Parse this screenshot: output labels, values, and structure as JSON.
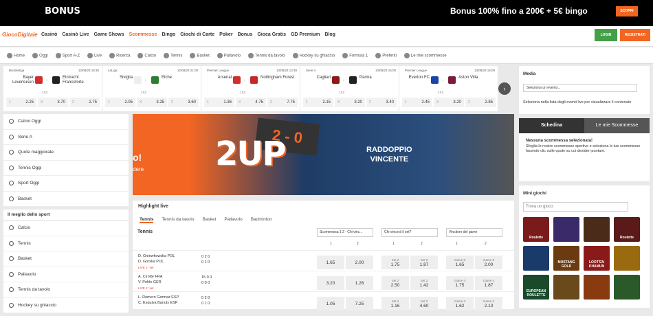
{
  "topbar": {
    "logo": "BONUS BENVENUTO",
    "promo": "Bonus 100% fino a 200€ + 5€ bingo",
    "scopri": "SCOPRI"
  },
  "nav": {
    "brand": "GiocoDigitale",
    "items": [
      "Casinò",
      "Casinò Live",
      "Game Shows",
      "Scommesse",
      "Bingo",
      "Giochi di Carte",
      "Poker",
      "Bonus",
      "Gioca Gratis",
      "GD Premium",
      "Blog"
    ],
    "active": "Scommesse",
    "login": "LOGIN",
    "register": "REGISTRATI"
  },
  "subnav": [
    "Home",
    "Oggi",
    "Sport A-Z",
    "Live",
    "Ricerca",
    "Calcio",
    "Tennis",
    "Basket",
    "Pallavolo",
    "Tennis da tavolo",
    "Hockey su ghiaccio",
    "Formula 1",
    "Preferiti",
    "Le mie scommesse"
  ],
  "matches": [
    {
      "league": "Bundesliga",
      "date": "12/08/23 18:30",
      "home": "Bayer Leverkusen",
      "away": "Eintracht Francoforte",
      "c1": "#d32f2f",
      "c2": "#222",
      "market": "1X2",
      "odds": [
        "2.25",
        "3.70",
        "2.75"
      ]
    },
    {
      "league": "LaLiga",
      "date": "12/08/23 21:00",
      "home": "Siviglia",
      "away": "Elche",
      "c1": "#eee",
      "c2": "#2e7d32",
      "market": "1X2",
      "odds": [
        "2.05",
        "3.25",
        "3.60"
      ]
    },
    {
      "league": "Premier League",
      "date": "13/08/23 13:30",
      "home": "Arsenal",
      "away": "Nottingham Forest",
      "c1": "#d32f2f",
      "c2": "#c62828",
      "market": "1X2",
      "odds": [
        "1.36",
        "4.75",
        "7.75"
      ]
    },
    {
      "league": "Serie A",
      "date": "13/08/23 15:00",
      "home": "Cagliari",
      "away": "Parma",
      "c1": "#8b1a1a",
      "c2": "#222",
      "market": "1X2",
      "odds": [
        "2.15",
        "3.20",
        "3.40"
      ]
    },
    {
      "league": "Premier League",
      "date": "13/08/23 16:00",
      "home": "Everton FC",
      "away": "Aston Villa",
      "c1": "#1a47a6",
      "c2": "#7a1c3c",
      "market": "1X2",
      "odds": [
        "2.45",
        "3.20",
        "2.85"
      ]
    }
  ],
  "left": {
    "quick": [
      "Calcio Oggi",
      "Serie A",
      "Quote maggiorate",
      "Tennis Oggi",
      "Sport Oggi",
      "Basket"
    ],
    "best_title": "Il meglio dello sport",
    "best": [
      "Calcio",
      "Tennis",
      "Basket",
      "Pallavolo",
      "Tennis da tavolo",
      "Hockey su ghiaccio"
    ]
  },
  "banner": {
    "line1": "RADDOPPIO",
    "line2": "VINCENTE",
    "big": "2UP",
    "score": "2 - 0",
    "o": "o!",
    "dere": "dere"
  },
  "highlight": {
    "title": "Highlight live",
    "tabs": [
      "Tennis",
      "Tennis da tavolo",
      "Basket",
      "Pallavolo",
      "Badminton"
    ],
    "sport": "Tennis",
    "selects": [
      "Scommessa 1 2 - Chi vinc...",
      "Chi vincerà il set?",
      "Vincitore del game"
    ],
    "cols": [
      "1",
      "2",
      "1",
      "2",
      "1",
      "2"
    ],
    "rows": [
      {
        "p1": "D. Gniewkowska POL",
        "p2": "D. Gorska POL",
        "live": "LIVE 1° set",
        "s1": "0 2 0",
        "s2": "0 1 0",
        "o": [
          "1.65",
          "2.00"
        ],
        "set": [
          "Set 2",
          "1.75",
          "Set 2",
          "1.87"
        ],
        "game": [
          "Game 5",
          "1.65",
          "Game 5",
          "2.00"
        ]
      },
      {
        "p1": "A. Cirotte FRA",
        "p2": "V. Pohle GER",
        "live": "LIVE 1° set",
        "s1": "15 0 0",
        "s2": "0 0 0",
        "o": [
          "3.20",
          "1.26"
        ],
        "set": [
          "Set 2",
          "2.50",
          "Set 2",
          "1.42"
        ],
        "game": [
          "Game 4",
          "1.75",
          "Game 4",
          "1.87"
        ]
      },
      {
        "p1": "L. Romero Gormaz ESP",
        "p2": "C. Esquiva Banuls ESP",
        "live": "",
        "s1": "0 2 0",
        "s2": "0 1 0",
        "o": [
          "1.05",
          "7.25"
        ],
        "set": [
          "Set 2",
          "1.16",
          "Set 2",
          "4.60"
        ],
        "game": [
          "Game 3",
          "1.62",
          "Game 3",
          "2.10"
        ]
      }
    ]
  },
  "right": {
    "media_title": "Media",
    "media_select": "Seleziona un evento...",
    "media_info": "Seleziona  nella lista degli eventi live per visualizzare il contenuto",
    "slip_tabs": [
      "Schedina",
      "Le mie Scommesse"
    ],
    "slip_title": "Nessuna scommessa selezionata!",
    "slip_text": "Sfoglia le nostre scommesse sportive e seleziona le tue scommesse facendo clic sulle quote su cui desideri puntare.",
    "mini_title": "Mini giochi",
    "mini_search": "Trova un gioco",
    "games": [
      {
        "n": "Roulette",
        "c": "#7b1a1a"
      },
      {
        "n": "",
        "c": "#3a2a6a"
      },
      {
        "n": "",
        "c": "#4a2a18"
      },
      {
        "n": "Roulette",
        "c": "#5a1a1a"
      },
      {
        "n": "",
        "c": "#1a3a6a"
      },
      {
        "n": "MUSTANG GOLD",
        "c": "#6a3a10"
      },
      {
        "n": "LOOT'EN KHAMUN",
        "c": "#8a1a1a"
      },
      {
        "n": "",
        "c": "#9a6a10"
      },
      {
        "n": "EUROPEAN ROULETTE",
        "c": "#1a4a2a"
      },
      {
        "n": "",
        "c": "#6a4a1a"
      },
      {
        "n": "",
        "c": "#8a3a10"
      },
      {
        "n": "",
        "c": "#2a5a2a"
      }
    ]
  }
}
